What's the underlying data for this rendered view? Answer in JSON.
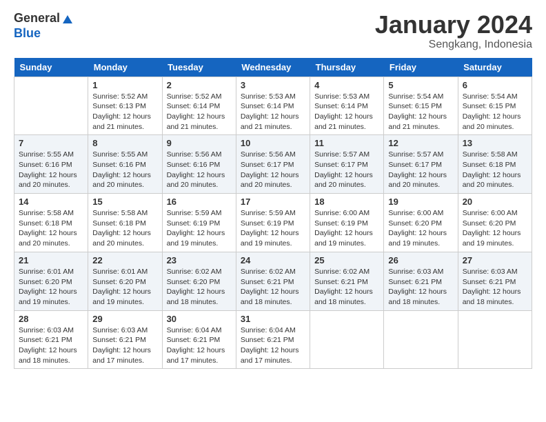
{
  "header": {
    "logo_line1": "General",
    "logo_line2": "Blue",
    "title": "January 2024",
    "subtitle": "Sengkang, Indonesia"
  },
  "days_of_week": [
    "Sunday",
    "Monday",
    "Tuesday",
    "Wednesday",
    "Thursday",
    "Friday",
    "Saturday"
  ],
  "weeks": [
    [
      {
        "day": null
      },
      {
        "day": 1,
        "sunrise": "5:52 AM",
        "sunset": "6:13 PM",
        "daylight": "12 hours and 21 minutes."
      },
      {
        "day": 2,
        "sunrise": "5:52 AM",
        "sunset": "6:14 PM",
        "daylight": "12 hours and 21 minutes."
      },
      {
        "day": 3,
        "sunrise": "5:53 AM",
        "sunset": "6:14 PM",
        "daylight": "12 hours and 21 minutes."
      },
      {
        "day": 4,
        "sunrise": "5:53 AM",
        "sunset": "6:14 PM",
        "daylight": "12 hours and 21 minutes."
      },
      {
        "day": 5,
        "sunrise": "5:54 AM",
        "sunset": "6:15 PM",
        "daylight": "12 hours and 21 minutes."
      },
      {
        "day": 6,
        "sunrise": "5:54 AM",
        "sunset": "6:15 PM",
        "daylight": "12 hours and 20 minutes."
      }
    ],
    [
      {
        "day": 7,
        "sunrise": "5:55 AM",
        "sunset": "6:16 PM",
        "daylight": "12 hours and 20 minutes."
      },
      {
        "day": 8,
        "sunrise": "5:55 AM",
        "sunset": "6:16 PM",
        "daylight": "12 hours and 20 minutes."
      },
      {
        "day": 9,
        "sunrise": "5:56 AM",
        "sunset": "6:16 PM",
        "daylight": "12 hours and 20 minutes."
      },
      {
        "day": 10,
        "sunrise": "5:56 AM",
        "sunset": "6:17 PM",
        "daylight": "12 hours and 20 minutes."
      },
      {
        "day": 11,
        "sunrise": "5:57 AM",
        "sunset": "6:17 PM",
        "daylight": "12 hours and 20 minutes."
      },
      {
        "day": 12,
        "sunrise": "5:57 AM",
        "sunset": "6:17 PM",
        "daylight": "12 hours and 20 minutes."
      },
      {
        "day": 13,
        "sunrise": "5:58 AM",
        "sunset": "6:18 PM",
        "daylight": "12 hours and 20 minutes."
      }
    ],
    [
      {
        "day": 14,
        "sunrise": "5:58 AM",
        "sunset": "6:18 PM",
        "daylight": "12 hours and 20 minutes."
      },
      {
        "day": 15,
        "sunrise": "5:58 AM",
        "sunset": "6:18 PM",
        "daylight": "12 hours and 20 minutes."
      },
      {
        "day": 16,
        "sunrise": "5:59 AM",
        "sunset": "6:19 PM",
        "daylight": "12 hours and 19 minutes."
      },
      {
        "day": 17,
        "sunrise": "5:59 AM",
        "sunset": "6:19 PM",
        "daylight": "12 hours and 19 minutes."
      },
      {
        "day": 18,
        "sunrise": "6:00 AM",
        "sunset": "6:19 PM",
        "daylight": "12 hours and 19 minutes."
      },
      {
        "day": 19,
        "sunrise": "6:00 AM",
        "sunset": "6:20 PM",
        "daylight": "12 hours and 19 minutes."
      },
      {
        "day": 20,
        "sunrise": "6:00 AM",
        "sunset": "6:20 PM",
        "daylight": "12 hours and 19 minutes."
      }
    ],
    [
      {
        "day": 21,
        "sunrise": "6:01 AM",
        "sunset": "6:20 PM",
        "daylight": "12 hours and 19 minutes."
      },
      {
        "day": 22,
        "sunrise": "6:01 AM",
        "sunset": "6:20 PM",
        "daylight": "12 hours and 19 minutes."
      },
      {
        "day": 23,
        "sunrise": "6:02 AM",
        "sunset": "6:20 PM",
        "daylight": "12 hours and 18 minutes."
      },
      {
        "day": 24,
        "sunrise": "6:02 AM",
        "sunset": "6:21 PM",
        "daylight": "12 hours and 18 minutes."
      },
      {
        "day": 25,
        "sunrise": "6:02 AM",
        "sunset": "6:21 PM",
        "daylight": "12 hours and 18 minutes."
      },
      {
        "day": 26,
        "sunrise": "6:03 AM",
        "sunset": "6:21 PM",
        "daylight": "12 hours and 18 minutes."
      },
      {
        "day": 27,
        "sunrise": "6:03 AM",
        "sunset": "6:21 PM",
        "daylight": "12 hours and 18 minutes."
      }
    ],
    [
      {
        "day": 28,
        "sunrise": "6:03 AM",
        "sunset": "6:21 PM",
        "daylight": "12 hours and 18 minutes."
      },
      {
        "day": 29,
        "sunrise": "6:03 AM",
        "sunset": "6:21 PM",
        "daylight": "12 hours and 17 minutes."
      },
      {
        "day": 30,
        "sunrise": "6:04 AM",
        "sunset": "6:21 PM",
        "daylight": "12 hours and 17 minutes."
      },
      {
        "day": 31,
        "sunrise": "6:04 AM",
        "sunset": "6:21 PM",
        "daylight": "12 hours and 17 minutes."
      },
      {
        "day": null
      },
      {
        "day": null
      },
      {
        "day": null
      }
    ]
  ],
  "labels": {
    "sunrise_prefix": "Sunrise:",
    "sunset_prefix": "Sunset:",
    "daylight_prefix": "Daylight:"
  }
}
